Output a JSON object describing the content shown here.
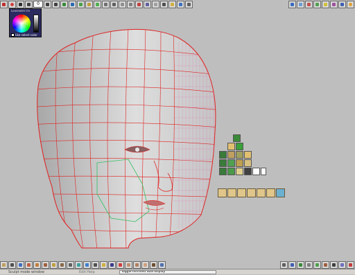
{
  "colors": {
    "workspace": "#bebebe",
    "wire": "#e02020",
    "hilite": "#30c060",
    "skin": "#d8d8d8",
    "palette_title": "#2a2a60"
  },
  "top_toolbar": {
    "frame_value": "0",
    "icons": [
      "stop-icon",
      "record-icon",
      "play-icon",
      "step-back-icon",
      "frame-field",
      "step-forward-icon",
      "end-icon",
      "pencil-icon",
      "select-icon",
      "move-icon",
      "rotate-icon",
      "scale-icon",
      "brush-icon",
      "sculpt-icon",
      "smooth-icon",
      "pinch-icon",
      "inflate-icon",
      "layers-icon",
      "render-icon",
      "camera-icon",
      "light-icon",
      "grid-icon",
      "view-icon"
    ]
  },
  "top_right_toolbar": {
    "icons": [
      "magnet-icon",
      "mesh-icon",
      "texture-icon",
      "paint-icon",
      "lights-icon",
      "stage-icon",
      "render-preview-icon",
      "sun-icon"
    ]
  },
  "color_picker": {
    "title": "Loosewire Iris",
    "label": "Use select color"
  },
  "bottom_toolbar": {
    "icons": [
      "file-icon",
      "open-icon",
      "save-icon",
      "undo-icon",
      "redo-icon",
      "cut-icon",
      "copy-icon",
      "paste-icon",
      "model-icon",
      "brush-preset-icon",
      "material-icon",
      "camera-view-icon",
      "light-preset-icon",
      "scene-icon",
      "animation-icon",
      "face-icon",
      "figure-icon",
      "hand-icon",
      "hair-icon",
      "cloth-icon"
    ]
  },
  "bottom_right_toolbar": {
    "icons": [
      "grid-toggle-icon",
      "perspective-icon",
      "wireframe-icon",
      "shaded-icon",
      "hidden-line-icon",
      "textured-icon",
      "smooth-shade-icon",
      "flat-shade-icon",
      "lit-icon"
    ]
  },
  "status": {
    "left_text": "Sculpt mode window",
    "mid_text": "Edit   Help",
    "center_text": "Toggle mirrored SDS display"
  }
}
